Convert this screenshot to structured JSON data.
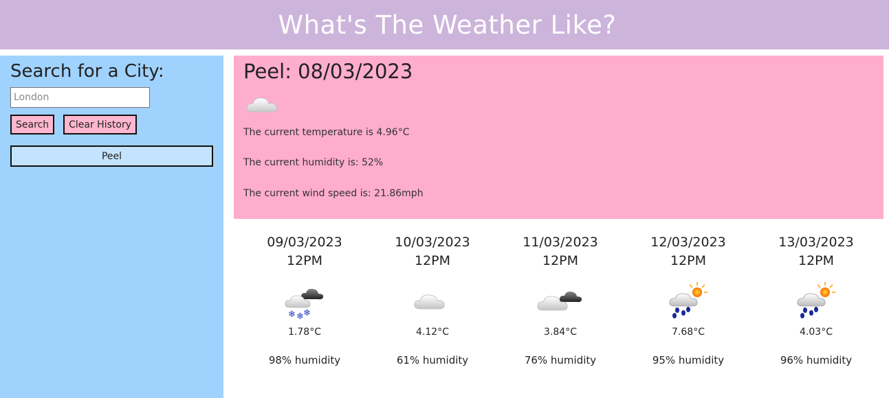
{
  "header": {
    "title": "What's The Weather Like?"
  },
  "sidebar": {
    "heading": "Search for a City:",
    "search_placeholder": "London",
    "search_button": "Search",
    "clear_button": "Clear History",
    "history": [
      "Peel"
    ]
  },
  "current": {
    "title": "Peel: 08/03/2023",
    "icon": "cloud-icon",
    "temperature": "The current temperature is 4.96°C",
    "humidity": "The current humidity is: 52%",
    "wind": "The current wind speed is: 21.86mph"
  },
  "forecast": [
    {
      "date": "09/03/2023",
      "time": "12PM",
      "icon": "snow-cloud-icon",
      "temp": "1.78°C",
      "humidity": "98% humidity"
    },
    {
      "date": "10/03/2023",
      "time": "12PM",
      "icon": "cloud-icon",
      "temp": "4.12°C",
      "humidity": "61% humidity"
    },
    {
      "date": "11/03/2023",
      "time": "12PM",
      "icon": "broken-clouds-icon",
      "temp": "3.84°C",
      "humidity": "76% humidity"
    },
    {
      "date": "12/03/2023",
      "time": "12PM",
      "icon": "rain-sun-icon",
      "temp": "7.68°C",
      "humidity": "95% humidity"
    },
    {
      "date": "13/03/2023",
      "time": "12PM",
      "icon": "rain-sun-icon",
      "temp": "4.03°C",
      "humidity": "96% humidity"
    }
  ]
}
